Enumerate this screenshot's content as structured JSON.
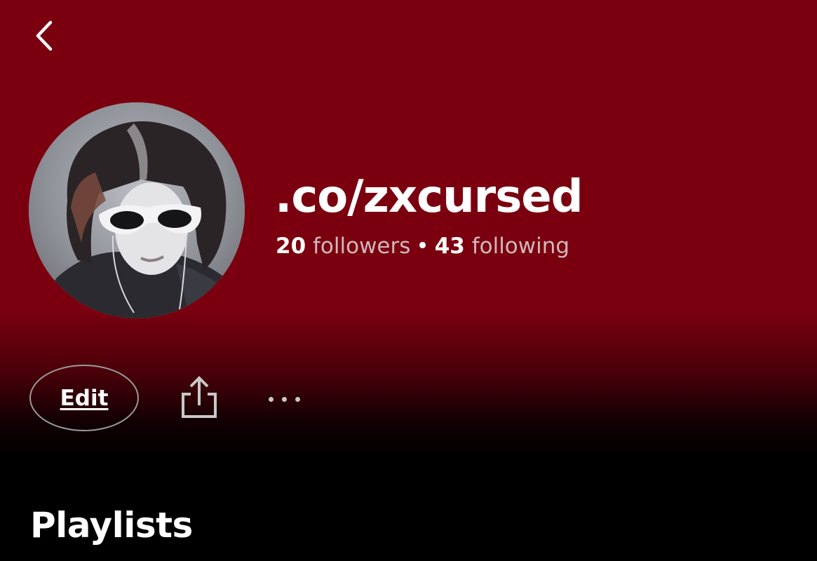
{
  "colors": {
    "header_background": "#7b000f",
    "body_background": "#000000",
    "text_primary": "#ffffff",
    "text_secondary": "#cfb9bd"
  },
  "nav": {
    "back_icon": "chevron-left-icon"
  },
  "profile": {
    "avatar_icon": "profile-avatar",
    "name": ".co/zxcursed",
    "followers_count": "20",
    "followers_label": "followers",
    "separator": "•",
    "following_count": "43",
    "following_label": "following"
  },
  "actions": {
    "edit_label": "Edit",
    "share_icon": "share-icon",
    "more_icon": "more-options-icon"
  },
  "sections": {
    "playlists_title": "Playlists"
  }
}
